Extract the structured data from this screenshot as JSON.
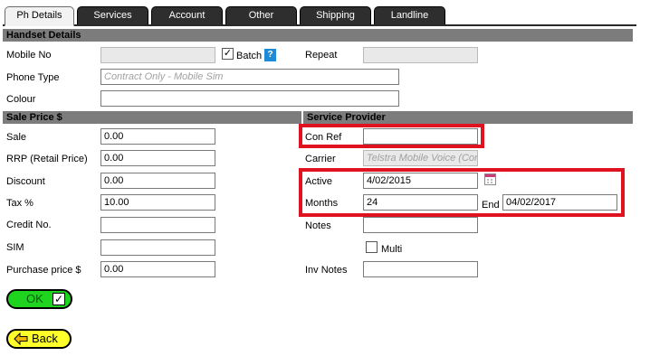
{
  "tabs": [
    {
      "label": "Ph Details"
    },
    {
      "label": "Services"
    },
    {
      "label": "Account"
    },
    {
      "label": "Other"
    },
    {
      "label": "Shipping"
    },
    {
      "label": "Landline"
    }
  ],
  "handset": {
    "section_title": "Handset Details",
    "mobile_no_label": "Mobile No",
    "mobile_no_value": "",
    "batch_label": "Batch",
    "batch_checked": true,
    "help_label": "?",
    "repeat_label": "Repeat",
    "repeat_value": "",
    "phone_type_label": "Phone Type",
    "phone_type_placeholder": "Contract Only - Mobile Sim",
    "colour_label": "Colour",
    "colour_value": ""
  },
  "sale": {
    "section_title": "Sale Price $",
    "sale_label": "Sale",
    "sale_value": "0.00",
    "rrp_label": "RRP (Retail Price)",
    "rrp_value": "0.00",
    "discount_label": "Discount",
    "discount_value": "0.00",
    "tax_label": "Tax %",
    "tax_value": "10.00",
    "credit_label": "Credit No.",
    "credit_value": "",
    "sim_label": "SIM",
    "sim_value": "",
    "purchase_label": "Purchase price $",
    "purchase_value": "0.00"
  },
  "service": {
    "section_title": "Service Provider",
    "con_ref_label": "Con Ref",
    "con_ref_value": "",
    "carrier_label": "Carrier",
    "carrier_placeholder": "Telstra Mobile Voice (Con",
    "active_label": "Active",
    "active_value": "4/02/2015",
    "months_label": "Months",
    "months_value": "24",
    "end_label": "End",
    "end_value": "04/02/2017",
    "notes_label": "Notes",
    "notes_value": "",
    "multi_label": "Multi",
    "multi_checked": false,
    "inv_notes_label": "Inv Notes",
    "inv_notes_value": ""
  },
  "buttons": {
    "ok_label": "OK",
    "ok_check": "✓",
    "back_label": "Back"
  },
  "colors": {
    "highlight_red": "#e0121f",
    "section_bar": "#7c7c7c",
    "tab_dark": "#2e2e2e",
    "ok_green": "#1ed41e",
    "back_yellow": "#ffff2a"
  }
}
